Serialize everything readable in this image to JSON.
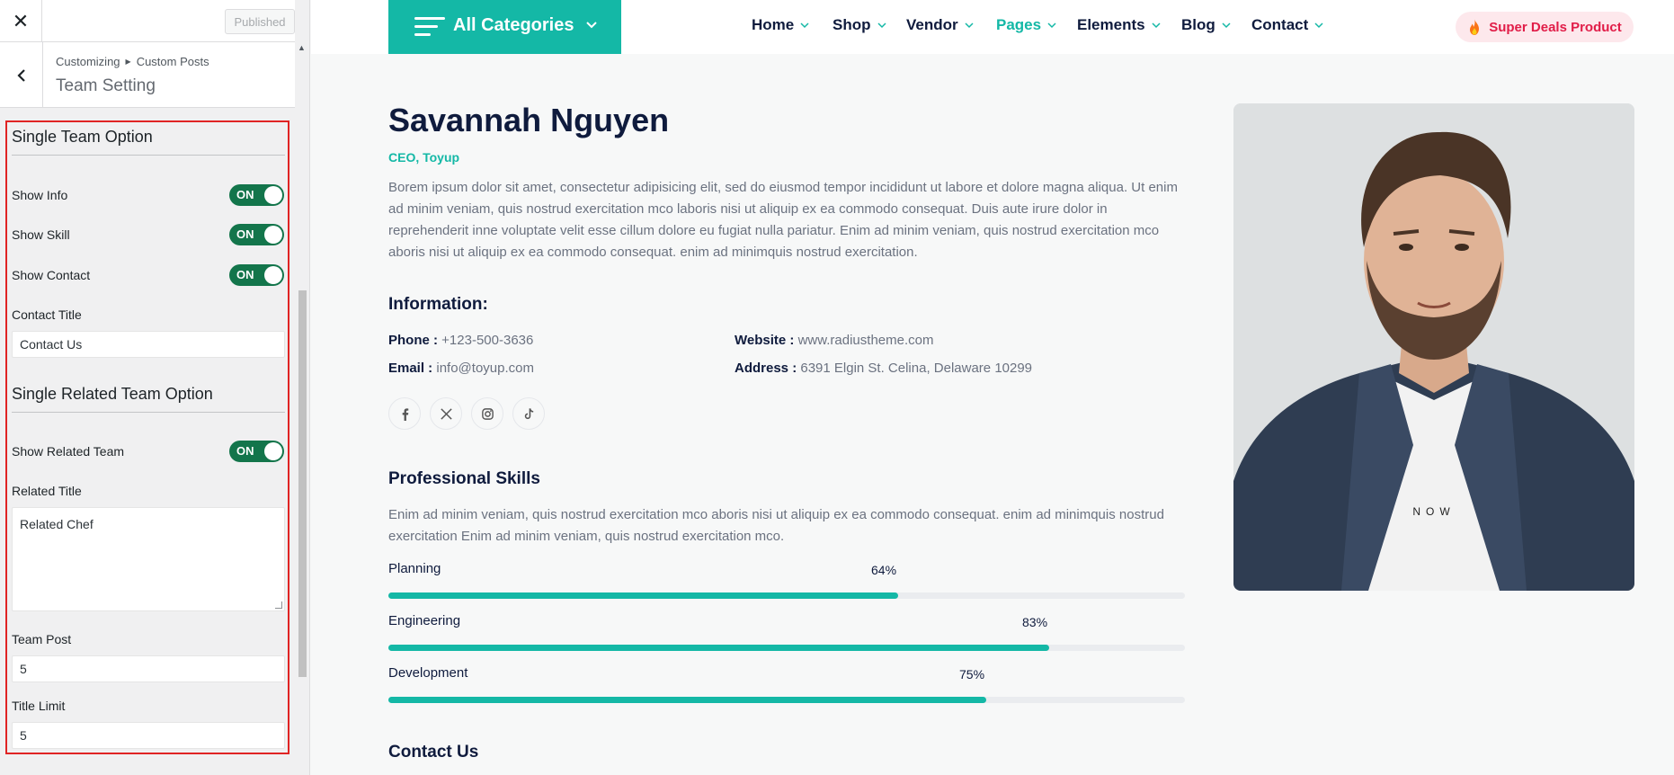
{
  "customizer": {
    "close_icon": "close-icon",
    "publish_label": "Published",
    "breadcrumb_root": "Customizing",
    "breadcrumb_child": "Custom Posts",
    "section_title": "Team Setting",
    "single_team_heading": "Single Team Option",
    "show_info_label": "Show Info",
    "show_skill_label": "Show Skill",
    "show_contact_label": "Show Contact",
    "toggle_on_label": "ON",
    "contact_title_label": "Contact Title",
    "contact_title_value": "Contact Us",
    "related_heading": "Single Related Team Option",
    "show_related_label": "Show Related Team",
    "related_title_label": "Related Title",
    "related_title_value": "Related Chef",
    "team_post_label": "Team Post",
    "team_post_value": "5",
    "title_limit_label": "Title Limit",
    "title_limit_value": "5"
  },
  "header": {
    "categories_label": "All Categories",
    "nav": [
      {
        "label": "Home"
      },
      {
        "label": "Shop"
      },
      {
        "label": "Vendor"
      },
      {
        "label": "Pages"
      },
      {
        "label": "Elements"
      },
      {
        "label": "Blog"
      },
      {
        "label": "Contact"
      }
    ],
    "deals_label": "Super Deals Product"
  },
  "profile": {
    "name": "Savannah Nguyen",
    "role": "CEO, Toyup",
    "bio": "Borem ipsum dolor sit amet, consectetur adipisicing elit, sed do eiusmod tempor incididunt ut labore et dolore magna aliqua. Ut enim ad minim veniam, quis nostrud exercitation mco laboris nisi ut aliquip ex ea commodo consequat. Duis aute irure dolor in reprehenderit inne voluptate velit esse cillum dolore eu fugiat nulla pariatur. Enim ad minim veniam, quis nostrud exercitation mco aboris nisi ut aliquip ex ea commodo consequat. enim ad minimquis nostrud exercitation.",
    "info_heading": "Information:",
    "phone_label": "Phone :",
    "phone_value": "+123-500-3636",
    "email_label": "Email :",
    "email_value": "info@toyup.com",
    "website_label": "Website :",
    "website_value": "www.radiustheme.com",
    "address_label": "Address :",
    "address_value": "6391 Elgin St. Celina, Delaware 10299",
    "socials": [
      "facebook-icon",
      "x-icon",
      "instagram-icon",
      "tiktok-icon"
    ],
    "skills_heading": "Professional Skills",
    "skills_text": "Enim ad minim veniam, quis nostrud exercitation mco aboris nisi ut aliquip ex ea commodo consequat. enim ad minimquis nostrud exercitation Enim ad minim veniam, quis nostrud exercitation mco.",
    "skills": [
      {
        "label": "Planning",
        "percent_label": "64%",
        "value": 64
      },
      {
        "label": "Engineering",
        "percent_label": "83%",
        "value": 83
      },
      {
        "label": "Development",
        "percent_label": "75%",
        "value": 75
      }
    ],
    "contact_heading": "Contact Us",
    "photo_icon": "portrait-photo"
  },
  "colors": {
    "accent": "#14b8a6",
    "toggle_on": "#13754b",
    "highlight_border": "#e02424",
    "deals_text": "#e11d48"
  }
}
